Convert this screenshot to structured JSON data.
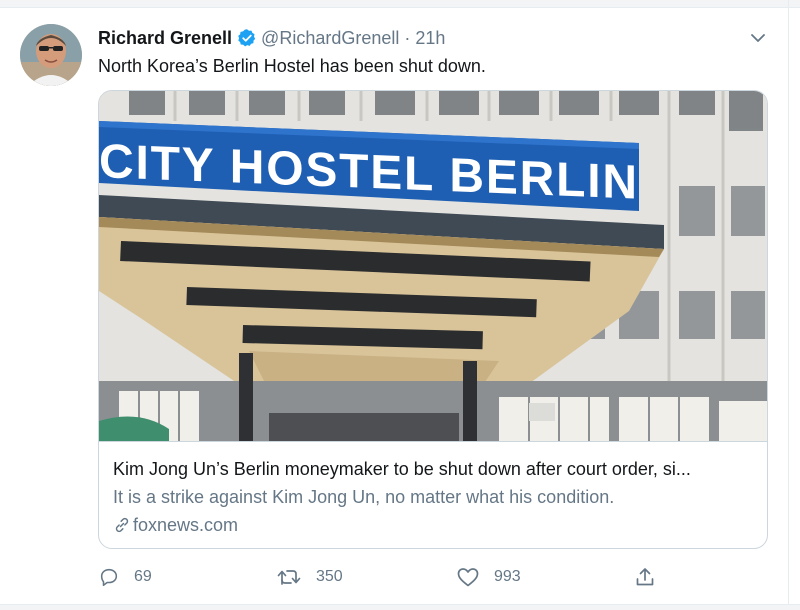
{
  "tweet": {
    "author_name": "Richard Grenell",
    "handle": "@RichardGrenell",
    "separator": "·",
    "time": "21h",
    "text": "North Korea’s Berlin Hostel has been shut down."
  },
  "card": {
    "image_sign_text": "CITY HOSTEL BERLIN",
    "title": "Kim Jong Un’s Berlin moneymaker to be shut down after court order, si...",
    "description": "It is a strike against Kim Jong Un, no matter what his condition.",
    "domain": "foxnews.com"
  },
  "actions": {
    "replies": "69",
    "retweets": "350",
    "likes": "993"
  },
  "icons": {
    "verified": "verified-badge-icon",
    "more": "chevron-down-icon",
    "link": "link-icon",
    "reply": "reply-icon",
    "retweet": "retweet-icon",
    "like": "heart-icon",
    "share": "share-icon"
  },
  "colors": {
    "verified_blue": "#1da1f2",
    "secondary_text": "#657786",
    "border": "#ccd6dd"
  }
}
